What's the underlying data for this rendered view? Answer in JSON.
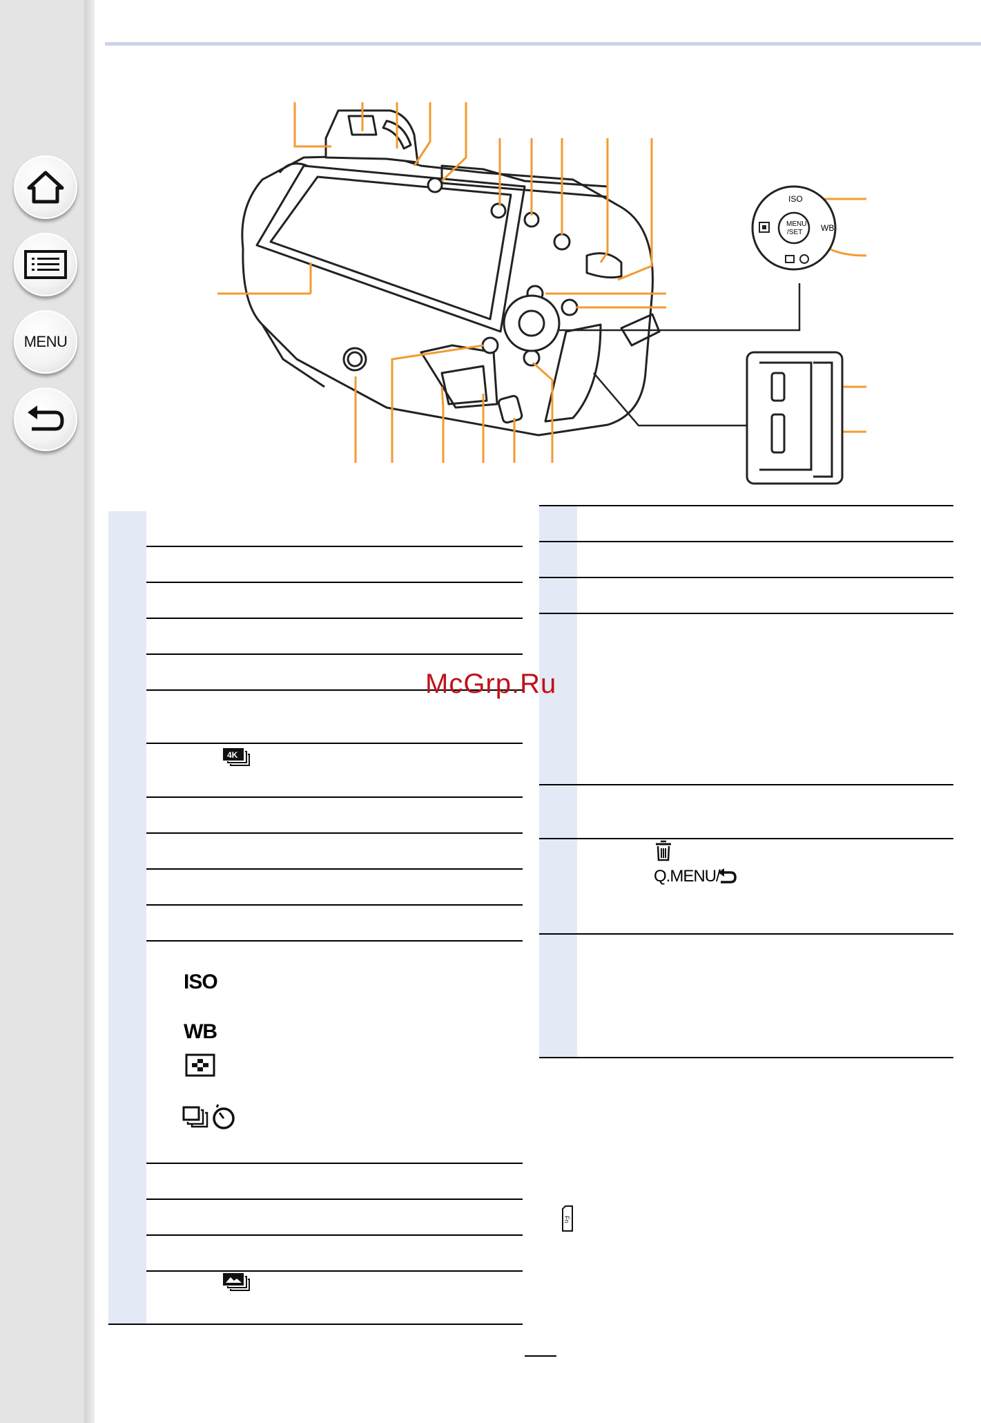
{
  "nav": {
    "home_icon": "home-icon",
    "contents_icon": "list-icon",
    "menu_label": "MENU",
    "back_icon": "return-arrow-icon"
  },
  "diagram": {
    "cursor_button": {
      "top": "ISO",
      "right": "WB",
      "center_line1": "MENU",
      "center_line2": "/SET"
    }
  },
  "left_table_icons": {
    "row7_icon": "4k-photo-icon",
    "row12_iso": "ISO",
    "row12_wb": "WB",
    "row12_af_icon": "af-mode-icon",
    "row12_drive_icon": "drive-mode-self-timer-icon",
    "row16_icon": "post-focus-icon"
  },
  "right_table_icons": {
    "row6_trash_icon": "trash-icon",
    "row6_qmenu": "Q.MENU/",
    "row6_back_icon": "return-icon"
  },
  "fn_icon": "fn-icon",
  "watermark": "McGrp.Ru",
  "colors": {
    "accent_orange": "#f29b30",
    "header_rule": "#c9d2ec",
    "number_cell": "#e4e9f6",
    "watermark": "#c0111a"
  }
}
